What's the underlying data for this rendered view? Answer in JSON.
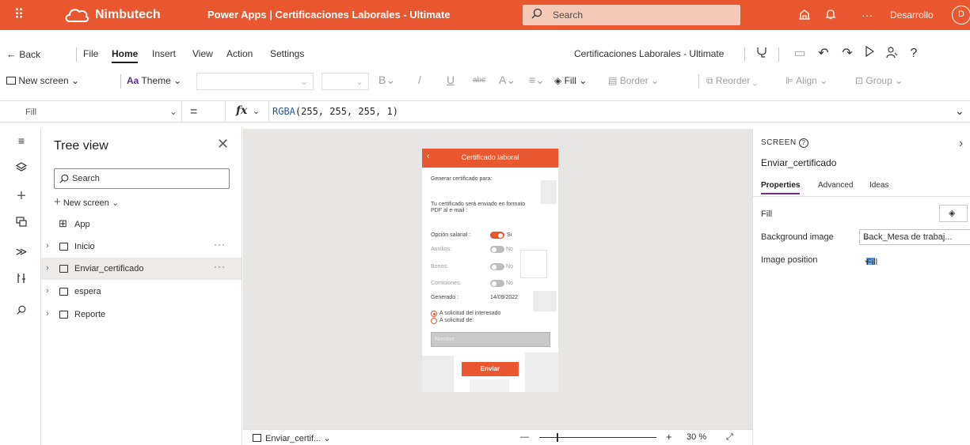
{
  "topbar": {
    "brand": "Nimbutech",
    "app_title": "Power Apps  |  Certificaciones Laborales - Ultimate",
    "search_placeholder": "Search",
    "env_label": "Desarrollo",
    "avatar_initial": "D",
    "more": "···",
    "color": "#e8572f"
  },
  "menu": {
    "back": "Back",
    "items": [
      "File",
      "Home",
      "Insert",
      "View",
      "Action",
      "Settings"
    ],
    "active": "Home",
    "doc_name": "Certificaciones Laborales - Ultimate"
  },
  "toolbar": {
    "new_screen": "New screen",
    "theme": "Theme",
    "fill": "Fill",
    "border": "Border",
    "reorder": "Reorder",
    "align": "Align",
    "group": "Group"
  },
  "formula": {
    "property": "Fill",
    "fn": "RGBA",
    "args": "(255, 255, 255, 1)"
  },
  "tree": {
    "title": "Tree view",
    "search_placeholder": "Search",
    "new_screen": "New screen",
    "app": "App",
    "screens": [
      {
        "name": "Inicio",
        "more": "···"
      },
      {
        "name": "Enviar_certificado",
        "more": "···",
        "selected": true
      },
      {
        "name": "espera"
      },
      {
        "name": "Reporte"
      }
    ]
  },
  "phone": {
    "header": "Certificado laboral",
    "gen_label": "Generar certificado para:",
    "email_label_1": "Tu certificado será enviado en formato",
    "email_label_2": "PDF al e-mail :",
    "salary_label": "Opción salarial :",
    "salary_value": "Si",
    "auxilios_label": "Auxilios:",
    "auxilios_value": "No",
    "bonos_label": "Bonos:",
    "bonos_value": "No",
    "comisiones_label": "Comisiones:",
    "comisiones_value": "No",
    "generado_label": "Generado :",
    "generado_value": "14/09/2022",
    "radio_1": "A solicitud del interesado",
    "radio_2": "A solicitud de:",
    "name_placeholder": "Nombre",
    "button": "Enviar"
  },
  "canvas_bar": {
    "screen": "Enviar_certif...",
    "zoom_minus": "—",
    "zoom_plus": "+",
    "zoom": "30",
    "zoom_unit": "%"
  },
  "props": {
    "kind": "SCREEN",
    "name": "Enviar_certificado",
    "tabs": [
      "Properties",
      "Advanced",
      "Ideas"
    ],
    "fill_label": "Fill",
    "bg_label": "Background image",
    "bg_value": "Back_Mesa de trabaj...",
    "pos_label": "Image position",
    "pos_value": "Fill"
  }
}
